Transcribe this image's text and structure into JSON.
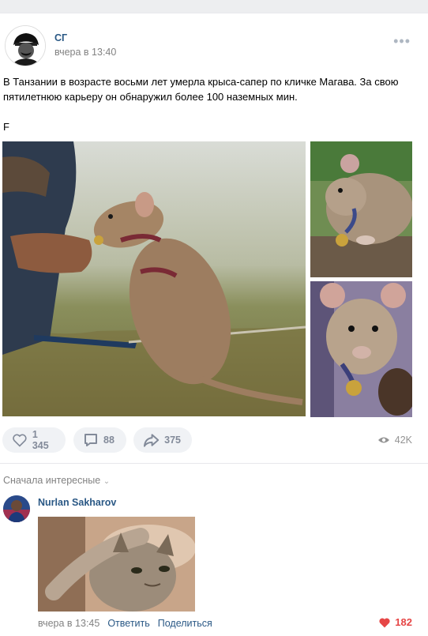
{
  "post": {
    "author": "СГ",
    "time": "вчера в 13:40",
    "text": "В Танзании в возрасте восьми лет умерла крыса-сапер по кличке Магава. За свою пятилетнюю карьеру он обнаружил более 100 наземных мин.",
    "extra_line": "F",
    "more_icon": "more-dots-icon",
    "photos": [
      {
        "subject": "rat-with-hand",
        "bg": "#9aa079"
      },
      {
        "subject": "rat-with-medal-top",
        "bg": "#7a8a5e"
      },
      {
        "subject": "rat-with-medal-bottom",
        "bg": "#7d6f86"
      }
    ]
  },
  "actions": {
    "likes": "1 345",
    "comments": "88",
    "shares": "375",
    "views": "42K"
  },
  "comments_section": {
    "sort_label": "Сначала интересные"
  },
  "comment": {
    "author": "Nurlan Sakharov",
    "time": "вчера в 13:45",
    "reply_label": "Ответить",
    "share_label": "Поделиться",
    "likes": "182"
  },
  "colors": {
    "link": "#2a5885",
    "muted": "#828282",
    "like_active": "#e64646",
    "button_bg": "#f0f2f5"
  }
}
